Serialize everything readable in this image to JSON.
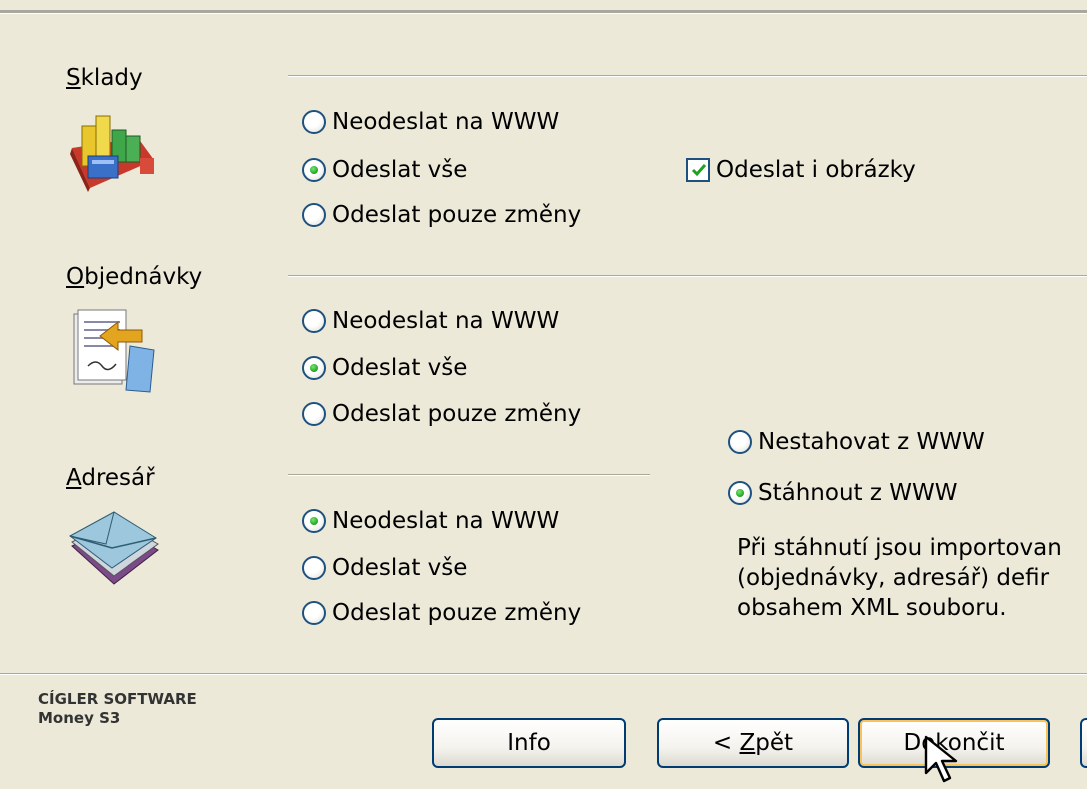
{
  "sections": {
    "sklady": {
      "label_mnemonic": "S",
      "label_rest": "klady",
      "icon": "warehouse-icon",
      "options": [
        "Neodeslat na WWW",
        "Odeslat vše",
        "Odeslat pouze změny"
      ],
      "selected": 1,
      "checkbox_label": "Odeslat i obrázky",
      "checkbox_checked": true
    },
    "objednavky": {
      "label_mnemonic": "O",
      "label_rest": "bjednávky",
      "icon": "orders-icon",
      "options": [
        "Neodeslat na WWW",
        "Odeslat vše",
        "Odeslat pouze změny"
      ],
      "selected": 1
    },
    "adresar": {
      "label_mnemonic": "A",
      "label_rest": "dresář",
      "icon": "address-book-envelope-icon",
      "options": [
        "Neodeslat na WWW",
        "Odeslat vše",
        "Odeslat pouze změny"
      ],
      "selected": 0
    }
  },
  "download": {
    "options": [
      "Nestahovat z WWW",
      "Stáhnout z WWW"
    ],
    "selected": 1,
    "note_lines": [
      "Při stáhnutí jsou importovan",
      "(objednávky, adresář) defir",
      "obsahem XML souboru."
    ]
  },
  "footer": {
    "company": "CÍGLER SOFTWARE",
    "product": "Money S3"
  },
  "buttons": {
    "info": "Info",
    "back_prefix": "< ",
    "back_mnemonic": "Z",
    "back_rest": "pět",
    "finish": "Dokončit"
  },
  "colors": {
    "background": "#ECE9D8",
    "radio_selected": "#21A121",
    "border_blue": "#1C5180"
  }
}
